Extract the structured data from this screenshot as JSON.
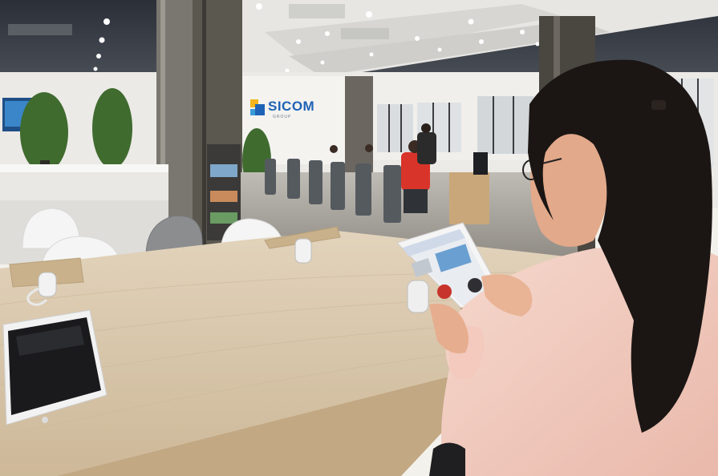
{
  "scene": {
    "signage": {
      "brand_name": "SICOM",
      "brand_sub": "GROUP"
    }
  },
  "colors": {
    "brand_blue": "#1f63b6",
    "brand_yellow": "#f2b51b",
    "desk_wood": "#d8c7ad",
    "blouse_pink": "#f2cfc4",
    "hair": "#1b1614"
  }
}
